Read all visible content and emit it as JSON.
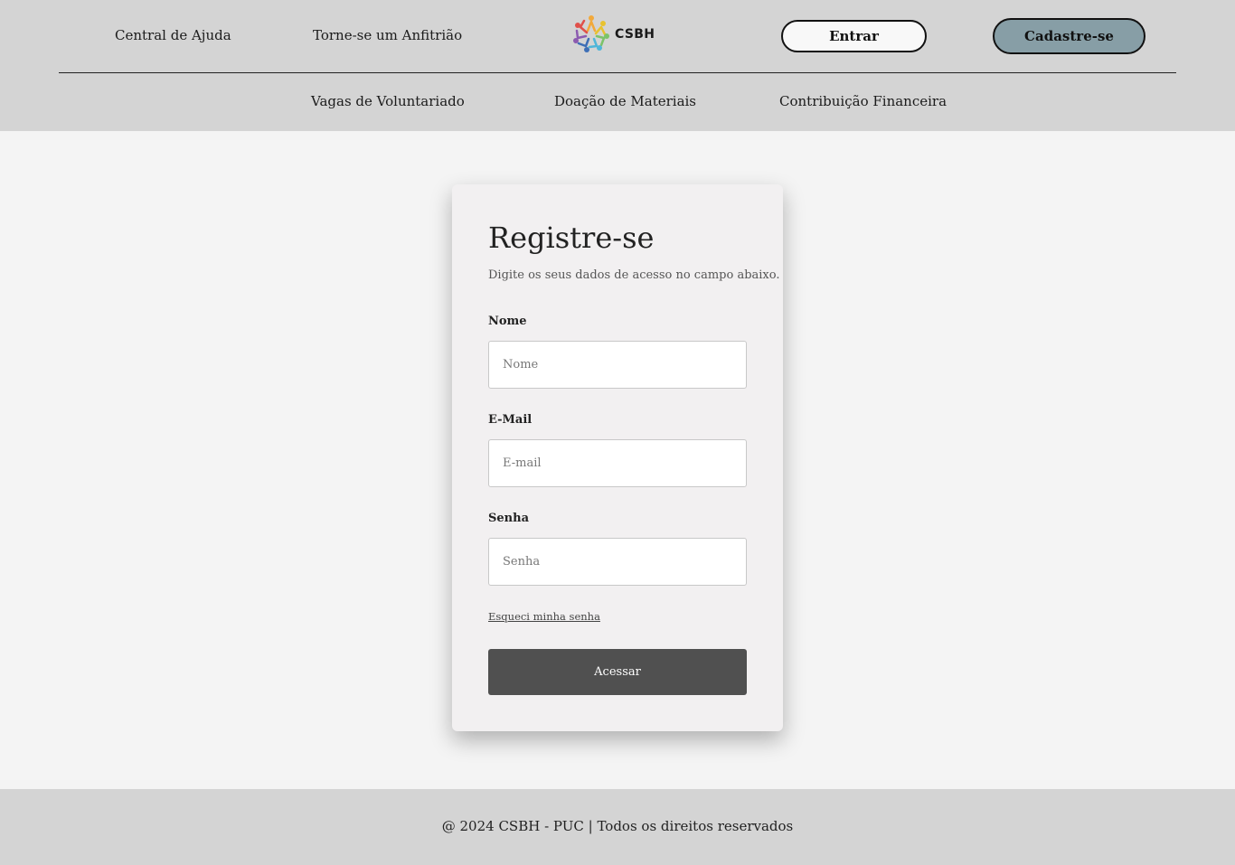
{
  "header": {
    "links_left": [
      {
        "label": "Central de Ajuda"
      },
      {
        "label": "Torne-se um Anfitrião"
      }
    ],
    "logo_text": "CSBH",
    "login_label": "Entrar",
    "signup_label": "Cadastre-se",
    "sub_nav": [
      {
        "label": "Vagas de Voluntariado"
      },
      {
        "label": "Doação de Materiais"
      },
      {
        "label": "Contribuição Financeira"
      }
    ]
  },
  "form": {
    "title": "Registre-se",
    "subtitle": "Digite os seus dados de acesso no campo abaixo.",
    "fields": [
      {
        "label": "Nome",
        "placeholder": "Nome",
        "value": ""
      },
      {
        "label": "E-Mail",
        "placeholder": "E-mail",
        "value": ""
      },
      {
        "label": "Senha",
        "placeholder": "Senha",
        "value": ""
      }
    ],
    "forgot_label": "Esqueci minha senha",
    "submit_label": "Acessar"
  },
  "footer": {
    "text": "@ 2024 CSBH - PUC | Todos os direitos reservados"
  },
  "colors": {
    "header_bg": "#d4d4d4",
    "page_bg": "#f4f4f4",
    "card_bg": "#f2f0f1",
    "signup_button_bg": "#879ea6",
    "submit_button_bg": "#505050"
  },
  "icons": {
    "logo": "people-circle-logo-icon"
  }
}
